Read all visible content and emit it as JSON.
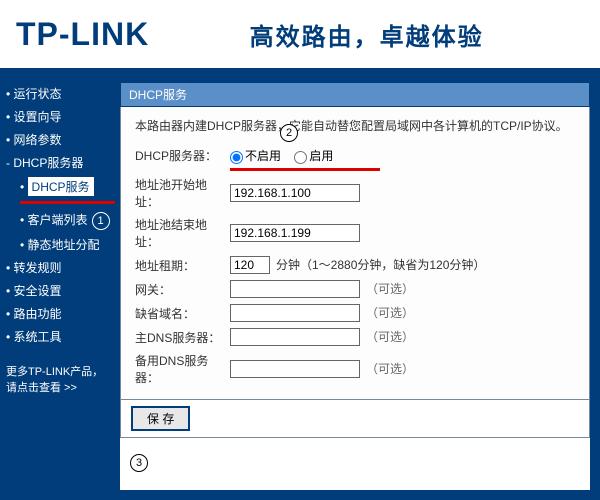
{
  "header": {
    "logo": "TP-LINK",
    "slogan": "高效路由，卓越体验"
  },
  "sidebar": {
    "items": [
      {
        "label": "运行状态"
      },
      {
        "label": "设置向导"
      },
      {
        "label": "网络参数"
      },
      {
        "label": "DHCP服务器"
      },
      {
        "label": "DHCP服务"
      },
      {
        "label": "客户端列表"
      },
      {
        "label": "静态地址分配"
      },
      {
        "label": "转发规则"
      },
      {
        "label": "安全设置"
      },
      {
        "label": "路由功能"
      },
      {
        "label": "系统工具"
      }
    ],
    "footer": "更多TP-LINK产品，请点击查看 >>",
    "annot1": "1"
  },
  "panel": {
    "title": "DHCP服务",
    "desc": "本路由器内建DHCP服务器，它能自动替您配置局域网中各计算机的TCP/IP协议。",
    "labels": {
      "server": "DHCP服务器：",
      "start": "地址池开始地址：",
      "end": "地址池结束地址：",
      "lease": "地址租期：",
      "gateway": "网关：",
      "domain": "缺省域名：",
      "dns1": "主DNS服务器：",
      "dns2": "备用DNS服务器："
    },
    "radio": {
      "disable": "不启用",
      "enable": "启用"
    },
    "values": {
      "start": "192.168.1.100",
      "end": "192.168.1.199",
      "lease": "120",
      "gateway": "",
      "domain": "",
      "dns1": "",
      "dns2": ""
    },
    "lease_hint": "分钟（1～2880分钟，缺省为120分钟）",
    "optional": "（可选）",
    "save": "保 存",
    "annot2": "2",
    "annot3": "3"
  }
}
